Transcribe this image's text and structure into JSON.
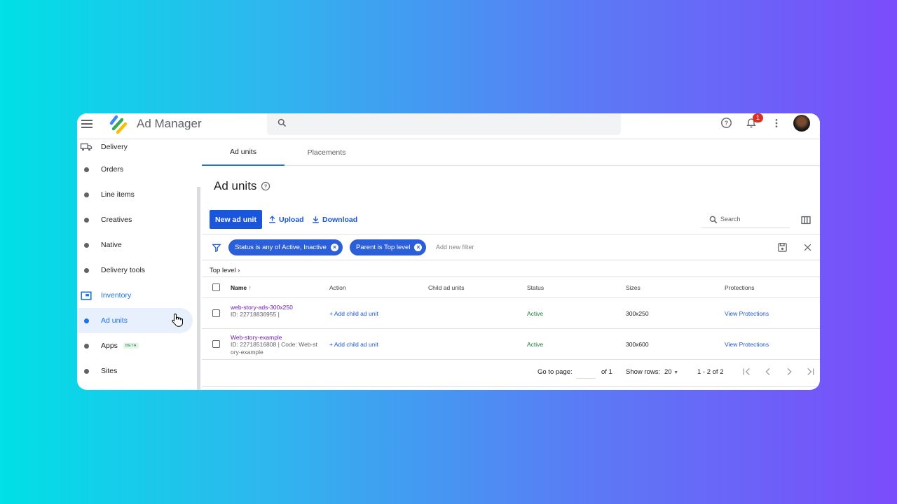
{
  "app": {
    "title": "Ad Manager",
    "notification_count": "1"
  },
  "sidebar": {
    "items": [
      {
        "label": "Delivery"
      },
      {
        "label": "Orders"
      },
      {
        "label": "Line items"
      },
      {
        "label": "Creatives"
      },
      {
        "label": "Native"
      },
      {
        "label": "Delivery tools"
      },
      {
        "label": "Inventory"
      },
      {
        "label": "Ad units"
      },
      {
        "label": "Apps",
        "badge": "BETA"
      },
      {
        "label": "Sites"
      }
    ]
  },
  "tabs": [
    {
      "label": "Ad units"
    },
    {
      "label": "Placements"
    }
  ],
  "page": {
    "title": "Ad units"
  },
  "toolbar": {
    "new_label": "New ad unit",
    "upload_label": "Upload",
    "download_label": "Download",
    "search_placeholder": "Search"
  },
  "filters": {
    "chips": [
      {
        "label": "Status is any of Active, Inactive"
      },
      {
        "label": "Parent is Top level"
      }
    ],
    "add_label": "Add new filter"
  },
  "breadcrumb": {
    "label": "Top level"
  },
  "table": {
    "headers": {
      "name": "Name",
      "action": "Action",
      "child": "Child ad units",
      "status": "Status",
      "sizes": "Sizes",
      "protections": "Protections"
    },
    "rows": [
      {
        "name": "web-story-ads-300x250",
        "sub": [
          "ID: 22718836955 |"
        ],
        "action": "+ Add child ad unit",
        "status": "Active",
        "sizes": "300x250",
        "protections": "View Protections"
      },
      {
        "name": "Web-story-example",
        "sub": [
          "ID: 22718516808 | Code: Web-st",
          "ory-example"
        ],
        "action": "+ Add child ad unit",
        "status": "Active",
        "sizes": "300x600",
        "protections": "View Protections"
      }
    ]
  },
  "pagination": {
    "goto_label": "Go to page:",
    "of_label": "of 1",
    "rows_label": "Show rows:",
    "rows_value": "20",
    "range": "1 - 2 of 2"
  },
  "colors": {
    "primary": "#1a56db",
    "active_status": "#188038",
    "link_visited": "#681da8"
  }
}
